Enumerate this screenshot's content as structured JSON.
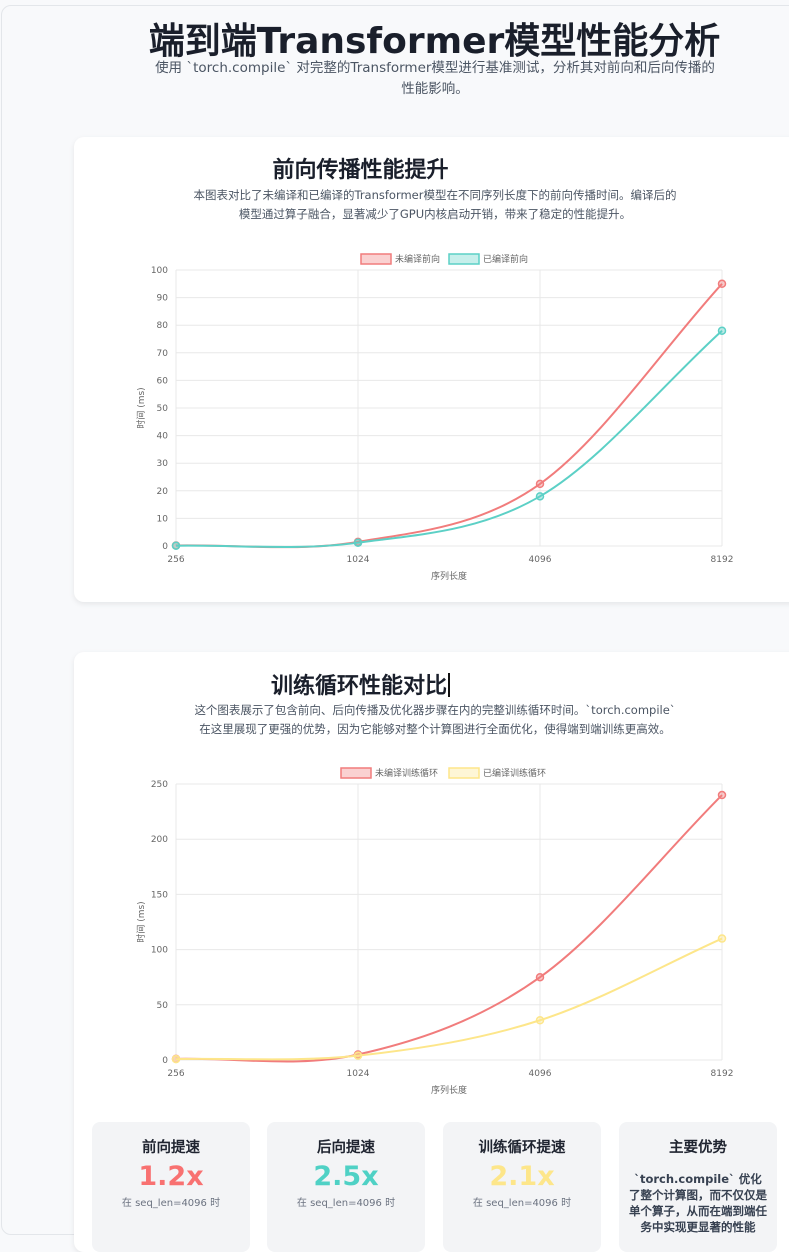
{
  "page": {
    "title": "端到端Transformer模型性能分析",
    "subtitle": "使用 `torch.compile` 对完整的Transformer模型进行基准测试，分析其对前向和后向传播的性能影响。"
  },
  "colors": {
    "red": "#f17c7c",
    "teal": "#5cd0c6",
    "yellow": "#fde68a"
  },
  "cards": [
    {
      "title": "前向传播性能提升",
      "desc_line1": "本图表对比了未编译和已编译的Transformer模型在不同序列长度下的前向传播时间。编译后的",
      "desc_line2": "模型通过算子融合，显著减少了GPU内核启动开销，带来了稳定的性能提升。"
    },
    {
      "title": "训练循环性能对比",
      "desc_line1": "这个图表展示了包含前向、后向传播及优化器步骤在内的完整训练循环时间。`torch.compile`",
      "desc_line2": "在这里展现了更强的优势，因为它能够对整个计算图进行全面优化，使得端到端训练更高效。"
    }
  ],
  "chart_data": [
    {
      "type": "line",
      "x": [
        "256",
        "1024",
        "4096",
        "8192"
      ],
      "xlabel": "序列长度",
      "ylabel": "时间 (ms)",
      "ylim": [
        0,
        100
      ],
      "yticks": [
        "0",
        "10",
        "20",
        "30",
        "40",
        "50",
        "60",
        "70",
        "80",
        "90",
        "100"
      ],
      "series": [
        {
          "name": "未编译前向",
          "values": [
            0.2,
            1.5,
            22.5,
            95
          ],
          "color": "#f17c7c"
        },
        {
          "name": "已编译前向",
          "values": [
            0.1,
            1.2,
            18,
            78
          ],
          "color": "#5cd0c6"
        }
      ],
      "grid": true,
      "legend": "top"
    },
    {
      "type": "line",
      "x": [
        "256",
        "1024",
        "4096",
        "8192"
      ],
      "xlabel": "序列长度",
      "ylabel": "时间 (ms)",
      "ylim": [
        0,
        250
      ],
      "yticks": [
        "0",
        "50",
        "100",
        "150",
        "200",
        "250"
      ],
      "series": [
        {
          "name": "未编译训练循环",
          "values": [
            1,
            5,
            75,
            240
          ],
          "color": "#f17c7c"
        },
        {
          "name": "已编译训练循环",
          "values": [
            0.8,
            4,
            36,
            110
          ],
          "color": "#fde68a"
        }
      ],
      "grid": true,
      "legend": "top"
    }
  ],
  "stats": [
    {
      "label": "前向提速",
      "value": "1.2x",
      "note": "在 seq_len=4096 时",
      "color": "#f87171"
    },
    {
      "label": "后向提速",
      "value": "2.5x",
      "note": "在 seq_len=4096 时",
      "color": "#4fd1c5"
    },
    {
      "label": "训练循环提速",
      "value": "2.1x",
      "note": "在 seq_len=4096 时",
      "color": "#fde68a"
    },
    {
      "label": "主要优势",
      "text": "`torch.compile` 优化了整个计算图，而不仅仅是单个算子，从而在端到端任务中实现更显著的性能"
    }
  ]
}
